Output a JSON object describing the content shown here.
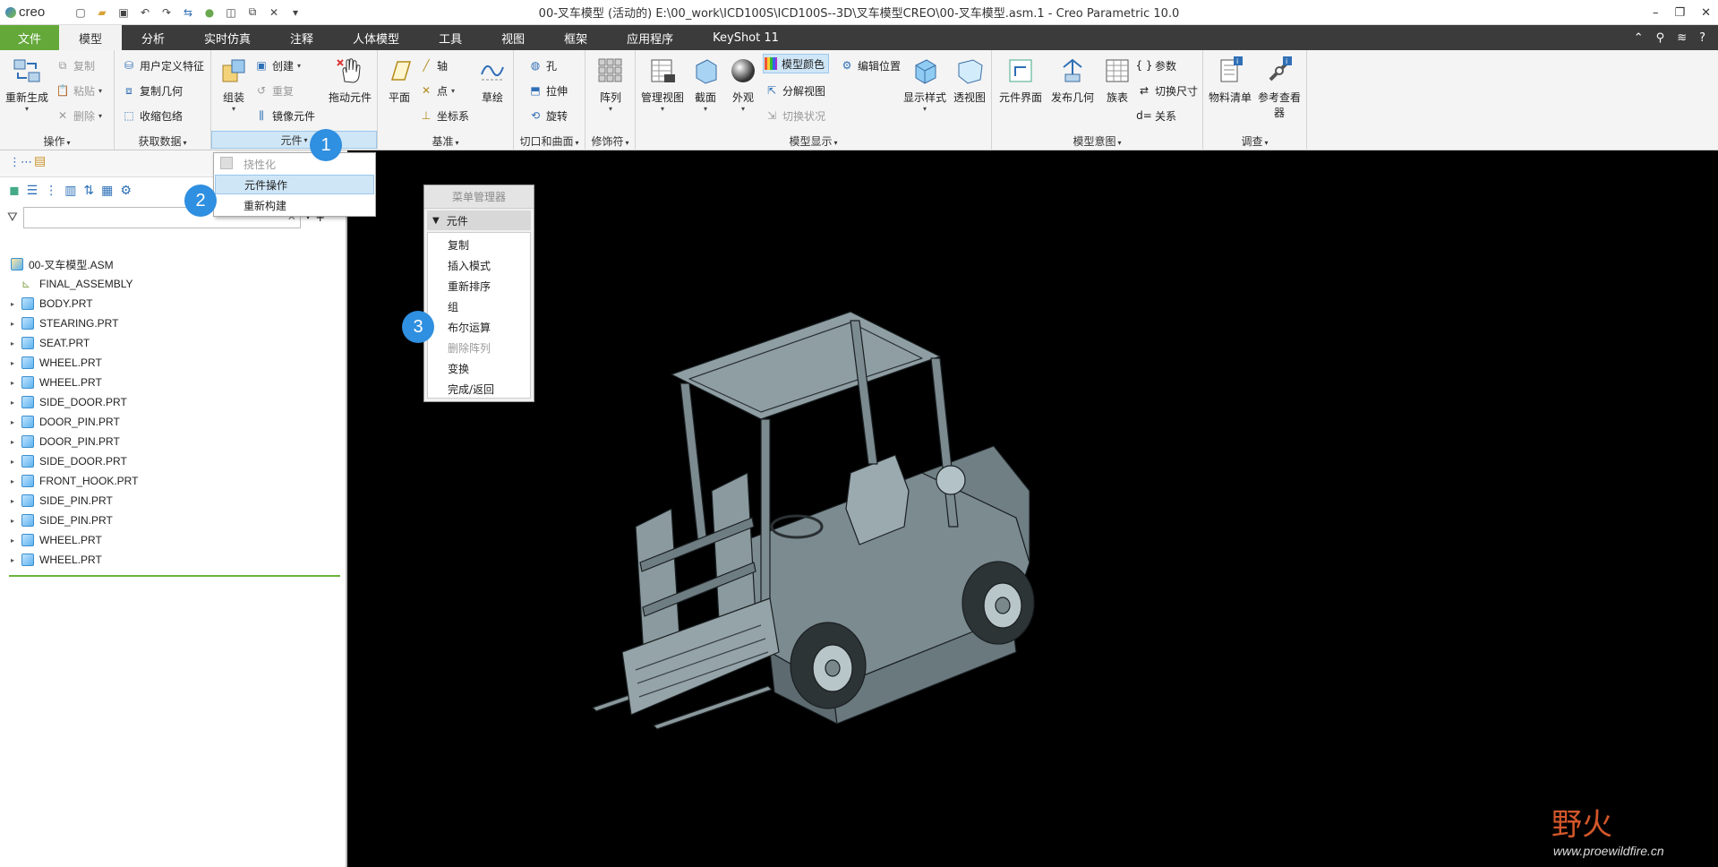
{
  "app": {
    "logo": "creo",
    "window_title": "00-叉车模型 (活动的) E:\\00_work\\ICD100S\\ICD100S--3D\\叉车模型CREO\\00-叉车模型.asm.1 - Creo Parametric 10.0"
  },
  "tabs": [
    {
      "label": "文件"
    },
    {
      "label": "模型"
    },
    {
      "label": "分析"
    },
    {
      "label": "实时仿真"
    },
    {
      "label": "注释"
    },
    {
      "label": "人体模型"
    },
    {
      "label": "工具"
    },
    {
      "label": "视图"
    },
    {
      "label": "框架"
    },
    {
      "label": "应用程序"
    },
    {
      "label": "KeyShot 11"
    }
  ],
  "ribbon": {
    "ops": {
      "regen": "重新生成",
      "copy": "复制",
      "paste": "粘贴",
      "delete": "删除",
      "label": "操作"
    },
    "getdata": {
      "udf": "用户定义特征",
      "copygeom": "复制几何",
      "shrinkwrap": "收缩包络",
      "label": "获取数据"
    },
    "component": {
      "assemble": "组装",
      "create": "创建",
      "repeat": "重复",
      "mirror": "镜像元件",
      "drag": "拖动元件",
      "label": "元件"
    },
    "datum": {
      "plane": "平面",
      "axis": "轴",
      "point": "点",
      "csys": "坐标系",
      "sketch": "草绘",
      "label": "基准"
    },
    "cut": {
      "hole": "孔",
      "extrude": "拉伸",
      "revolve": "旋转",
      "label": "切口和曲面"
    },
    "modifier": {
      "pattern": "阵列",
      "label": "修饰符"
    },
    "display": {
      "manage_views": "管理视图",
      "section": "截面",
      "appearance": "外观",
      "model_color": "模型颜色",
      "edit_position": "编辑位置",
      "explode": "分解视图",
      "toggle_status": "切换状况",
      "display_style": "显示样式",
      "perspective": "透视图",
      "label": "模型显示"
    },
    "intent": {
      "interface": "元件界面",
      "publish": "发布几何",
      "family": "族表",
      "params": "参数",
      "switch_dims": "切换尺寸",
      "relations": "关系",
      "label": "模型意图"
    },
    "investigate": {
      "bom": "物料清单",
      "ref_viewer": "参考查看器",
      "label": "调查"
    }
  },
  "dropdown": {
    "items": [
      {
        "label": "挠性化",
        "disabled": true
      },
      {
        "label": "元件操作",
        "selected": true
      },
      {
        "label": "重新构建"
      }
    ]
  },
  "tree": {
    "root": "00-叉车模型.ASM",
    "items": [
      "FINAL_ASSEMBLY",
      "BODY.PRT",
      "STEARING.PRT",
      "SEAT.PRT",
      "WHEEL.PRT",
      "WHEEL.PRT",
      "SIDE_DOOR.PRT",
      "DOOR_PIN.PRT",
      "DOOR_PIN.PRT",
      "SIDE_DOOR.PRT",
      "FRONT_HOOK.PRT",
      "SIDE_PIN.PRT",
      "SIDE_PIN.PRT",
      "WHEEL.PRT",
      "WHEEL.PRT"
    ]
  },
  "menu_manager": {
    "title": "菜单管理器",
    "section": "元件",
    "items": [
      {
        "label": "复制"
      },
      {
        "label": "插入模式"
      },
      {
        "label": "重新排序"
      },
      {
        "label": "组"
      },
      {
        "label": "布尔运算"
      },
      {
        "label": "删除阵列",
        "disabled": true
      },
      {
        "label": "变换"
      },
      {
        "label": "完成/返回"
      }
    ]
  },
  "badges": [
    "1",
    "2",
    "3"
  ],
  "watermark": {
    "cn": "野火",
    "url": "www.proewildfire.cn"
  }
}
